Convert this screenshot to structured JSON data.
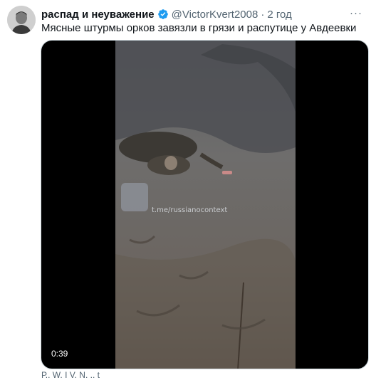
{
  "author": {
    "display_name": "распад и неуважение",
    "handle": "@VictorKvert2008",
    "separator": "·",
    "time": "2 год"
  },
  "tweet": {
    "text": "Мясные штурмы орков завязли в грязи и распутице у Авдеевки"
  },
  "media": {
    "watermark": "t.me/russianocontext",
    "duration": "0:39"
  },
  "footer": {
    "partial_text": "Р.. W. I V. N. .. t"
  },
  "icons": {
    "verified": "verified-badge-icon",
    "more": "more-options-icon"
  },
  "colors": {
    "verified": "#1d9bf0",
    "text": "#0f1419",
    "secondary": "#536471"
  }
}
